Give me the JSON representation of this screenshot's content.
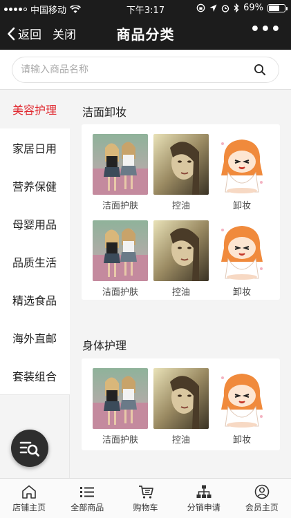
{
  "status_bar": {
    "carrier": "中国移动",
    "time": "下午3:17",
    "battery": "69%",
    "battery_level": 0.69
  },
  "nav": {
    "back_label": "返回",
    "close_label": "关闭",
    "title": "商品分类",
    "more_label": "•••"
  },
  "search": {
    "placeholder": "请输入商品名称",
    "value": ""
  },
  "sidebar": {
    "items": [
      {
        "label": "美容护理",
        "active": true
      },
      {
        "label": "家居日用",
        "active": false
      },
      {
        "label": "营养保健",
        "active": false
      },
      {
        "label": "母婴用品",
        "active": false
      },
      {
        "label": "品质生活",
        "active": false
      },
      {
        "label": "精选食品",
        "active": false
      },
      {
        "label": "海外直邮",
        "active": false
      },
      {
        "label": "套装组合",
        "active": false
      }
    ]
  },
  "sections": [
    {
      "title": "洁面卸妆",
      "products": [
        {
          "label": "洁面护肤",
          "image": "photo-girls"
        },
        {
          "label": "控油",
          "image": "photo-portrait"
        },
        {
          "label": "卸妆",
          "image": "cartoon-girl"
        },
        {
          "label": "洁面护肤",
          "image": "photo-girls"
        },
        {
          "label": "控油",
          "image": "photo-portrait"
        },
        {
          "label": "卸妆",
          "image": "cartoon-girl"
        }
      ]
    },
    {
      "title": "身体护理",
      "products": [
        {
          "label": "洁面护肤",
          "image": "photo-girls"
        },
        {
          "label": "控油",
          "image": "photo-portrait"
        },
        {
          "label": "卸妆",
          "image": "cartoon-girl"
        }
      ]
    }
  ],
  "tabbar": {
    "items": [
      {
        "label": "店铺主页",
        "icon": "home-icon"
      },
      {
        "label": "全部商品",
        "icon": "list-icon"
      },
      {
        "label": "购物车",
        "icon": "cart-icon"
      },
      {
        "label": "分销申请",
        "icon": "org-chart-icon"
      },
      {
        "label": "会员主页",
        "icon": "user-icon"
      }
    ]
  },
  "colors": {
    "accent": "#e0262d",
    "bar": "#1c1c1c"
  }
}
